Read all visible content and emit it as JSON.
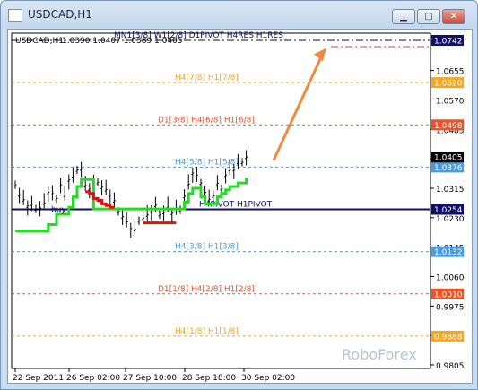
{
  "window": {
    "title": "USDCAD,H1",
    "buttons": [
      "minimize",
      "maximize",
      "close"
    ]
  },
  "chart_header": {
    "symbol": "USDCAD,H1",
    "ohlc": "1.0390 1.0407 1.0389 1.0405"
  },
  "watermark": "RoboForex",
  "chart_data": {
    "type": "line",
    "title": "USDCAD,H1",
    "xlabel": "",
    "ylabel": "",
    "x_ticks": [
      "22 Sep 2011",
      "26 Sep 02:00",
      "27 Sep 10:00",
      "28 Sep 18:00",
      "30 Sep 02:00"
    ],
    "y_ticks": [
      "1.0655",
      "1.0570",
      "1.0485",
      "1.0400",
      "1.0315",
      "1.0230",
      "1.0145",
      "1.0060",
      "0.9975",
      "0.9890",
      "0.9805"
    ],
    "ylim": [
      0.9805,
      1.0742
    ],
    "levels": [
      {
        "label": "MN1[3/8] W1[2/8] D1PIVOT H4RES H1RES",
        "value": 1.0742,
        "tag": "1.0742",
        "color": "#101010",
        "style": "dash-dot",
        "tag_bg": "#10106a"
      },
      {
        "label": "H4[7/8] H1[7/8]",
        "value": 1.062,
        "tag": "1.0620",
        "color": "#f5a623",
        "style": "dashed",
        "tag_bg": "#f5a623"
      },
      {
        "label": "D1[3/8] H4[6/8] H1[6/8]",
        "value": 1.0498,
        "tag": "1.0498",
        "color": "#e8542a",
        "style": "dashed",
        "tag_bg": "#e8542a"
      },
      {
        "label": "H4[5/8] H1[5/8]",
        "value": 1.0376,
        "tag": "1.0376",
        "color": "#4a9ae0",
        "style": "dashed",
        "tag_bg": "#4a9ae0"
      },
      {
        "label": "H4PIVOT H1PIVOT",
        "value": 1.0254,
        "tag": "1.0254",
        "color": "#10106a",
        "style": "solid",
        "tag_bg": "#10106a"
      },
      {
        "label": "H4[3/8] H1[3/8]",
        "value": 1.0132,
        "tag": "1.0132",
        "color": "#4a9ae0",
        "style": "dashed",
        "tag_bg": "#4a9ae0"
      },
      {
        "label": "D1[1/8] H4[2/8] H1[2/8]",
        "value": 1.001,
        "tag": "1.0010",
        "color": "#e8542a",
        "style": "dashed",
        "tag_bg": "#e8542a"
      },
      {
        "label": "H4[1/8] H1[1/8]",
        "value": 0.9888,
        "tag": "0.9888",
        "color": "#f5a623",
        "style": "dashed",
        "tag_bg": "#f5a623"
      }
    ],
    "current_price": {
      "value": 1.0405,
      "tag": "1.0405"
    },
    "bid_label": "buy",
    "series": [
      {
        "name": "",
        "kind": "price",
        "color": "#000000",
        "values": [
          1.0325,
          1.0296,
          1.0282,
          1.0264,
          1.0269,
          1.0255,
          1.0258,
          1.0273,
          1.0303,
          1.03,
          1.0285,
          1.0325,
          1.0295,
          1.0339,
          1.0351,
          1.0368,
          1.0371,
          1.0323,
          1.0314,
          1.033,
          1.0332,
          1.0318,
          1.0311,
          1.0295,
          1.0279,
          1.0248,
          1.0233,
          1.0218,
          1.0199,
          1.0196,
          1.0221,
          1.0229,
          1.0238,
          1.025,
          1.0266,
          1.0239,
          1.0245,
          1.0263,
          1.0243,
          1.0258,
          1.0253,
          1.0292,
          1.0327,
          1.0359,
          1.0353,
          1.033,
          1.0303,
          1.0283,
          1.0293,
          1.0329,
          1.0314,
          1.0353,
          1.0369,
          1.0369,
          1.039,
          1.039,
          1.0405
        ]
      },
      {
        "name": "",
        "kind": "trail",
        "color": "#22dd22",
        "values": [
          1.0192,
          1.0192,
          1.0192,
          1.0192,
          1.0192,
          1.0192,
          1.0192,
          1.0192,
          1.021,
          1.021,
          1.024,
          1.024,
          1.024,
          1.026,
          1.029,
          1.032,
          1.034,
          1.034,
          1.034,
          1.0255,
          1.0255,
          1.0255,
          1.0255,
          1.0255,
          1.0255,
          1.0255,
          1.0255,
          1.0255,
          1.0255,
          1.0255,
          1.0255,
          1.0255,
          1.0255,
          1.0255,
          1.0255,
          1.0255,
          1.0255,
          1.0255,
          1.0255,
          1.0255,
          1.0255,
          1.0275,
          1.03,
          1.0315,
          1.0315,
          1.029,
          1.027,
          1.027,
          1.027,
          1.029,
          1.03,
          1.031,
          1.032,
          1.032,
          1.033,
          1.033,
          1.0345
        ]
      },
      {
        "name": "",
        "kind": "trail",
        "color": "#e01010",
        "values": [
          null,
          null,
          null,
          null,
          null,
          null,
          null,
          null,
          null,
          null,
          null,
          null,
          null,
          null,
          null,
          null,
          null,
          1.0305,
          1.03,
          1.0285,
          1.028,
          1.027,
          1.0265,
          1.026,
          1.026,
          null,
          null,
          null,
          null,
          null,
          null,
          1.0215,
          1.0215,
          1.0215,
          1.0215,
          1.0215,
          1.0215,
          1.0215,
          1.0215,
          1.0215,
          null,
          null,
          null,
          null,
          null,
          null,
          null,
          null,
          null,
          null,
          null,
          null,
          null,
          null,
          null,
          null,
          null
        ]
      }
    ],
    "arrow": {
      "from": [
        1.0395,
        0.73
      ],
      "to": [
        1.072,
        0.82
      ],
      "color": "#f08a3c"
    }
  }
}
